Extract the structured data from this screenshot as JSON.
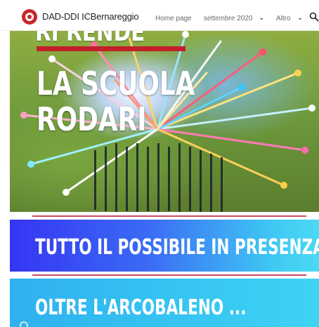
{
  "header": {
    "site_title": "DAD-DDI ICBernareggio",
    "nav": {
      "home": "Home page",
      "month": "settembre 2020",
      "more": "Altro"
    },
    "logo_icon": "school-logo-icon",
    "search_icon": "search-icon"
  },
  "hero": {
    "top_text": "RI RENDE",
    "line1": "LA SCUOLA",
    "line2": "RODARI",
    "accent_color": "#c31f2b"
  },
  "sections": [
    {
      "title": "TUTTO IL POSSIBILE IN PRESENZA",
      "color_start": "#3535f2",
      "color_end": "#4bd9f4"
    },
    {
      "title": "OLTRE L'ARCOBALENO ...",
      "color_start": "#2fb0f0",
      "color_end": "#3fd3f3"
    }
  ],
  "rule_color": "#c84a62"
}
